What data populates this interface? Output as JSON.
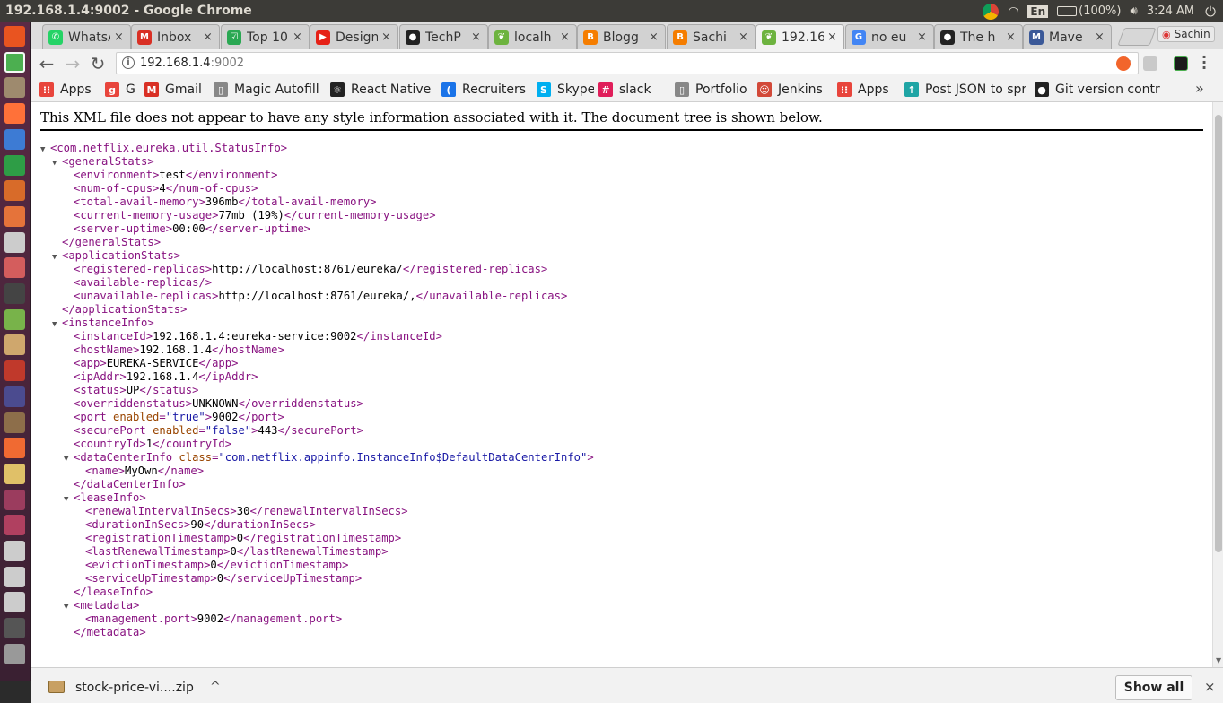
{
  "window": {
    "title": "192.168.1.4:9002 - Google Chrome"
  },
  "tray": {
    "lang": "En",
    "battery": "(100%)",
    "time": "3:24 AM"
  },
  "tabs": [
    {
      "label": "WhatsApp",
      "icon": "whatsapp-icon",
      "color": "#25d366",
      "glyph": "✆"
    },
    {
      "label": "Inbox",
      "icon": "gmail-icon",
      "color": "#d93025",
      "glyph": "M"
    },
    {
      "label": "Top 10",
      "icon": "sheet-icon",
      "color": "#2aa853",
      "glyph": "☑"
    },
    {
      "label": "Design",
      "icon": "youtube-icon",
      "color": "#e62117",
      "glyph": "▶"
    },
    {
      "label": "TechP",
      "icon": "github-icon",
      "color": "#222222",
      "glyph": "●"
    },
    {
      "label": "localh",
      "icon": "spring-leaf-icon",
      "color": "#6db33f",
      "glyph": "❦"
    },
    {
      "label": "Blogg",
      "icon": "blogger-icon",
      "color": "#f57d00",
      "glyph": "B"
    },
    {
      "label": "Sachi",
      "icon": "blogger-icon",
      "color": "#f57d00",
      "glyph": "B"
    },
    {
      "label": "192.16",
      "icon": "spring-leaf-icon",
      "color": "#6db33f",
      "glyph": "❦",
      "active": true
    },
    {
      "label": "no eu",
      "icon": "google-icon",
      "color": "#4285f4",
      "glyph": "G"
    },
    {
      "label": "The h",
      "icon": "github-icon",
      "color": "#222222",
      "glyph": "●"
    },
    {
      "label": "Mave",
      "icon": "maven-icon",
      "color": "#3b5998",
      "glyph": "M"
    }
  ],
  "tab_close": "×",
  "profile": {
    "name": "Sachin"
  },
  "toolbar": {
    "url_host": "192.168.1.4",
    "url_port": ":9002",
    "back": "←",
    "forward": "→",
    "reload": "↻",
    "star": "☆"
  },
  "bookmarks": [
    {
      "label": "Apps",
      "icon": "apps-grid-icon",
      "color": "#e8453c",
      "glyph": "⁞⁞"
    },
    {
      "label": "G",
      "icon": "g-icon",
      "color": "#e8453c",
      "glyph": "g"
    },
    {
      "label": "Gmail",
      "icon": "gmail-icon",
      "color": "#d93025",
      "glyph": "M"
    },
    {
      "label": "Magic Autofill",
      "icon": "page-icon",
      "color": "#888888",
      "glyph": "▯"
    },
    {
      "label": "React Native",
      "icon": "react-icon",
      "color": "#222222",
      "glyph": "⚛"
    },
    {
      "label": "Recruiters",
      "icon": "recruiters-icon",
      "color": "#1a73e8",
      "glyph": "("
    },
    {
      "label": "Skype",
      "icon": "skype-icon",
      "color": "#00aff0",
      "glyph": "S"
    },
    {
      "label": "slack",
      "icon": "slack-icon",
      "color": "#e01e5a",
      "glyph": "#"
    },
    {
      "label": "Portfolio",
      "icon": "page-icon",
      "color": "#888888",
      "glyph": "▯"
    },
    {
      "label": "Jenkins",
      "icon": "jenkins-icon",
      "color": "#d24939",
      "glyph": "☺"
    },
    {
      "label": "Apps",
      "icon": "apps-grid-icon",
      "color": "#e8453c",
      "glyph": "⁞⁞"
    },
    {
      "label": "Post JSON to spr",
      "icon": "pin-icon",
      "color": "#1fa5a5",
      "glyph": "↑"
    },
    {
      "label": "Git version contr",
      "icon": "github-icon",
      "color": "#222222",
      "glyph": "●"
    }
  ],
  "bookmarks_more": "»",
  "page": {
    "notice": "This XML file does not appear to have any style information associated with it. The document tree is shown below."
  },
  "xml_lines": [
    {
      "indent": 0,
      "tw": "▼",
      "segs": [
        [
          "t",
          "<com.netflix.eureka.util.StatusInfo>"
        ]
      ]
    },
    {
      "indent": 1,
      "tw": "▼",
      "segs": [
        [
          "t",
          "<generalStats>"
        ]
      ]
    },
    {
      "indent": 2,
      "tw": "",
      "segs": [
        [
          "t",
          "<environment>"
        ],
        [
          "x",
          "test"
        ],
        [
          "t",
          "</environment>"
        ]
      ]
    },
    {
      "indent": 2,
      "tw": "",
      "segs": [
        [
          "t",
          "<num-of-cpus>"
        ],
        [
          "x",
          "4"
        ],
        [
          "t",
          "</num-of-cpus>"
        ]
      ]
    },
    {
      "indent": 2,
      "tw": "",
      "segs": [
        [
          "t",
          "<total-avail-memory>"
        ],
        [
          "x",
          "396mb"
        ],
        [
          "t",
          "</total-avail-memory>"
        ]
      ]
    },
    {
      "indent": 2,
      "tw": "",
      "segs": [
        [
          "t",
          "<current-memory-usage>"
        ],
        [
          "x",
          "77mb (19%)"
        ],
        [
          "t",
          "</current-memory-usage>"
        ]
      ]
    },
    {
      "indent": 2,
      "tw": "",
      "segs": [
        [
          "t",
          "<server-uptime>"
        ],
        [
          "x",
          "00:00"
        ],
        [
          "t",
          "</server-uptime>"
        ]
      ]
    },
    {
      "indent": 1,
      "tw": "",
      "segs": [
        [
          "t",
          "</generalStats>"
        ]
      ]
    },
    {
      "indent": 1,
      "tw": "▼",
      "segs": [
        [
          "t",
          "<applicationStats>"
        ]
      ]
    },
    {
      "indent": 2,
      "tw": "",
      "segs": [
        [
          "t",
          "<registered-replicas>"
        ],
        [
          "x",
          "http://localhost:8761/eureka/"
        ],
        [
          "t",
          "</registered-replicas>"
        ]
      ]
    },
    {
      "indent": 2,
      "tw": "",
      "segs": [
        [
          "t",
          "<available-replicas/>"
        ]
      ]
    },
    {
      "indent": 2,
      "tw": "",
      "segs": [
        [
          "t",
          "<unavailable-replicas>"
        ],
        [
          "x",
          "http://localhost:8761/eureka/,"
        ],
        [
          "t",
          "</unavailable-replicas>"
        ]
      ]
    },
    {
      "indent": 1,
      "tw": "",
      "segs": [
        [
          "t",
          "</applicationStats>"
        ]
      ]
    },
    {
      "indent": 1,
      "tw": "▼",
      "segs": [
        [
          "t",
          "<instanceInfo>"
        ]
      ]
    },
    {
      "indent": 2,
      "tw": "",
      "segs": [
        [
          "t",
          "<instanceId>"
        ],
        [
          "x",
          "192.168.1.4:eureka-service:9002"
        ],
        [
          "t",
          "</instanceId>"
        ]
      ]
    },
    {
      "indent": 2,
      "tw": "",
      "segs": [
        [
          "t",
          "<hostName>"
        ],
        [
          "x",
          "192.168.1.4"
        ],
        [
          "t",
          "</hostName>"
        ]
      ]
    },
    {
      "indent": 2,
      "tw": "",
      "segs": [
        [
          "t",
          "<app>"
        ],
        [
          "x",
          "EUREKA-SERVICE"
        ],
        [
          "t",
          "</app>"
        ]
      ]
    },
    {
      "indent": 2,
      "tw": "",
      "segs": [
        [
          "t",
          "<ipAddr>"
        ],
        [
          "x",
          "192.168.1.4"
        ],
        [
          "t",
          "</ipAddr>"
        ]
      ]
    },
    {
      "indent": 2,
      "tw": "",
      "segs": [
        [
          "t",
          "<status>"
        ],
        [
          "x",
          "UP"
        ],
        [
          "t",
          "</status>"
        ]
      ]
    },
    {
      "indent": 2,
      "tw": "",
      "segs": [
        [
          "t",
          "<overriddenstatus>"
        ],
        [
          "x",
          "UNKNOWN"
        ],
        [
          "t",
          "</overriddenstatus>"
        ]
      ]
    },
    {
      "indent": 2,
      "tw": "",
      "segs": [
        [
          "t",
          "<port "
        ],
        [
          "a",
          "enabled"
        ],
        [
          "t",
          "="
        ],
        [
          "v",
          "\"true\""
        ],
        [
          "t",
          ">"
        ],
        [
          "x",
          "9002"
        ],
        [
          "t",
          "</port>"
        ]
      ]
    },
    {
      "indent": 2,
      "tw": "",
      "segs": [
        [
          "t",
          "<securePort "
        ],
        [
          "a",
          "enabled"
        ],
        [
          "t",
          "="
        ],
        [
          "v",
          "\"false\""
        ],
        [
          "t",
          ">"
        ],
        [
          "x",
          "443"
        ],
        [
          "t",
          "</securePort>"
        ]
      ]
    },
    {
      "indent": 2,
      "tw": "",
      "segs": [
        [
          "t",
          "<countryId>"
        ],
        [
          "x",
          "1"
        ],
        [
          "t",
          "</countryId>"
        ]
      ]
    },
    {
      "indent": 2,
      "tw": "▼",
      "segs": [
        [
          "t",
          "<dataCenterInfo "
        ],
        [
          "a",
          "class"
        ],
        [
          "t",
          "="
        ],
        [
          "v",
          "\"com.netflix.appinfo.InstanceInfo$DefaultDataCenterInfo\""
        ],
        [
          "t",
          ">"
        ]
      ]
    },
    {
      "indent": 3,
      "tw": "",
      "segs": [
        [
          "t",
          "<name>"
        ],
        [
          "x",
          "MyOwn"
        ],
        [
          "t",
          "</name>"
        ]
      ]
    },
    {
      "indent": 2,
      "tw": "",
      "segs": [
        [
          "t",
          "</dataCenterInfo>"
        ]
      ]
    },
    {
      "indent": 2,
      "tw": "▼",
      "segs": [
        [
          "t",
          "<leaseInfo>"
        ]
      ]
    },
    {
      "indent": 3,
      "tw": "",
      "segs": [
        [
          "t",
          "<renewalIntervalInSecs>"
        ],
        [
          "x",
          "30"
        ],
        [
          "t",
          "</renewalIntervalInSecs>"
        ]
      ]
    },
    {
      "indent": 3,
      "tw": "",
      "segs": [
        [
          "t",
          "<durationInSecs>"
        ],
        [
          "x",
          "90"
        ],
        [
          "t",
          "</durationInSecs>"
        ]
      ]
    },
    {
      "indent": 3,
      "tw": "",
      "segs": [
        [
          "t",
          "<registrationTimestamp>"
        ],
        [
          "x",
          "0"
        ],
        [
          "t",
          "</registrationTimestamp>"
        ]
      ]
    },
    {
      "indent": 3,
      "tw": "",
      "segs": [
        [
          "t",
          "<lastRenewalTimestamp>"
        ],
        [
          "x",
          "0"
        ],
        [
          "t",
          "</lastRenewalTimestamp>"
        ]
      ]
    },
    {
      "indent": 3,
      "tw": "",
      "segs": [
        [
          "t",
          "<evictionTimestamp>"
        ],
        [
          "x",
          "0"
        ],
        [
          "t",
          "</evictionTimestamp>"
        ]
      ]
    },
    {
      "indent": 3,
      "tw": "",
      "segs": [
        [
          "t",
          "<serviceUpTimestamp>"
        ],
        [
          "x",
          "0"
        ],
        [
          "t",
          "</serviceUpTimestamp>"
        ]
      ]
    },
    {
      "indent": 2,
      "tw": "",
      "segs": [
        [
          "t",
          "</leaseInfo>"
        ]
      ]
    },
    {
      "indent": 2,
      "tw": "▼",
      "segs": [
        [
          "t",
          "<metadata>"
        ]
      ]
    },
    {
      "indent": 3,
      "tw": "",
      "segs": [
        [
          "t",
          "<management.port>"
        ],
        [
          "x",
          "9002"
        ],
        [
          "t",
          "</management.port>"
        ]
      ]
    },
    {
      "indent": 2,
      "tw": "",
      "segs": [
        [
          "t",
          "</metadata>"
        ]
      ]
    }
  ],
  "download": {
    "filename": "stock-price-vi....zip",
    "chevron": "^",
    "show_all": "Show all",
    "close": "×"
  },
  "launcher_icons": [
    {
      "name": "ubuntu-dash-icon",
      "color": "#e95420"
    },
    {
      "name": "chrome-icon",
      "color": "#4caf50"
    },
    {
      "name": "files-icon",
      "color": "#9e8a6e"
    },
    {
      "name": "firefox-icon",
      "color": "#ff7139"
    },
    {
      "name": "writer-icon",
      "color": "#3d7bd4"
    },
    {
      "name": "calc-icon",
      "color": "#2e9d46"
    },
    {
      "name": "impress-icon",
      "color": "#d86b29"
    },
    {
      "name": "software-center-icon",
      "color": "#e5733a"
    },
    {
      "name": "amazon-icon",
      "color": "#cccccc"
    },
    {
      "name": "settings-icon",
      "color": "#d45d5d"
    },
    {
      "name": "terminal-icon",
      "color": "#444444"
    },
    {
      "name": "android-icon",
      "color": "#78b34a"
    },
    {
      "name": "image-viewer-icon",
      "color": "#cfa76d"
    },
    {
      "name": "filezilla-icon",
      "color": "#c0392b"
    },
    {
      "name": "eclipse-icon",
      "color": "#4b4b8f"
    },
    {
      "name": "system-tools-icon",
      "color": "#8d6e4a"
    },
    {
      "name": "postman-icon",
      "color": "#f06a32"
    },
    {
      "name": "text-editor-icon",
      "color": "#e0c068"
    },
    {
      "name": "studio-icon",
      "color": "#9b3c5e"
    },
    {
      "name": "app-icon",
      "color": "#b04060"
    },
    {
      "name": "drive-icon",
      "color": "#cccccc"
    },
    {
      "name": "drive-icon",
      "color": "#cccccc"
    },
    {
      "name": "drive-icon",
      "color": "#cccccc"
    },
    {
      "name": "usb-icon",
      "color": "#555555"
    },
    {
      "name": "trash-icon",
      "color": "#999999"
    }
  ]
}
